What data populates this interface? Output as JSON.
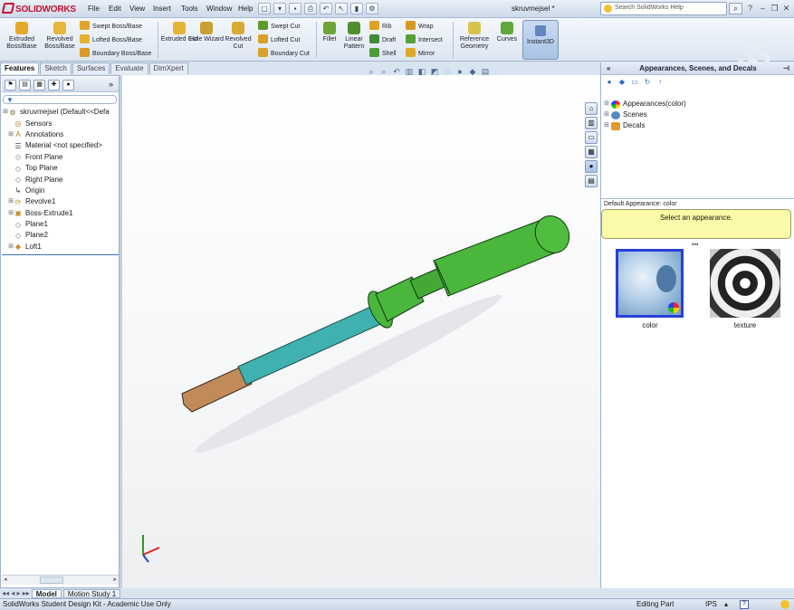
{
  "app": {
    "logo_text": "SOLIDWORKS",
    "document_title": "skruvmejsel *"
  },
  "menu": [
    "File",
    "Edit",
    "View",
    "Insert",
    "Tools",
    "Window",
    "Help"
  ],
  "search": {
    "placeholder": "Search SolidWorks Help"
  },
  "commands": {
    "extruded_boss": "Extruded Boss/Base",
    "revolved_boss": "Revolved Boss/Base",
    "swept_boss": "Swept Boss/Base",
    "lofted_boss": "Lofted Boss/Base",
    "boundary_boss": "Boundary Boss/Base",
    "extruded_cut": "Extruded Cut",
    "hole_wizard": "Hole Wizard",
    "revolved_cut": "Revolved Cut",
    "swept_cut": "Swept Cut",
    "lofted_cut": "Lofted Cut",
    "boundary_cut": "Boundary Cut",
    "fillet": "Fillet",
    "linear_pattern": "Linear Pattern",
    "rib": "Rib",
    "draft": "Draft",
    "shell": "Shell",
    "wrap": "Wrap",
    "intersect": "Intersect",
    "mirror": "Mirror",
    "reference_geometry": "Reference Geometry",
    "curves": "Curves",
    "instant3d": "Instant3D"
  },
  "tabs": [
    "Features",
    "Sketch",
    "Surfaces",
    "Evaluate",
    "DimXpert"
  ],
  "tree": [
    {
      "label": "skruvmejsel  (Default<<Defa",
      "icon": "part-icon",
      "indent": 0
    },
    {
      "label": "Sensors",
      "icon": "sensors-icon",
      "indent": 1
    },
    {
      "label": "Annotations",
      "icon": "annotations-icon",
      "indent": 1
    },
    {
      "label": "Material <not specified>",
      "icon": "material-icon",
      "indent": 1
    },
    {
      "label": "Front Plane",
      "icon": "plane-icon",
      "indent": 1
    },
    {
      "label": "Top Plane",
      "icon": "plane-icon",
      "indent": 1
    },
    {
      "label": "Right Plane",
      "icon": "plane-icon",
      "indent": 1
    },
    {
      "label": "Origin",
      "icon": "origin-icon",
      "indent": 1
    },
    {
      "label": "Revolve1",
      "icon": "revolve-icon",
      "indent": 1
    },
    {
      "label": "Boss-Extrude1",
      "icon": "extrude-icon",
      "indent": 1
    },
    {
      "label": "Plane1",
      "icon": "plane-icon",
      "indent": 1
    },
    {
      "label": "Plane2",
      "icon": "plane-icon",
      "indent": 1
    },
    {
      "label": "Loft1",
      "icon": "loft-icon",
      "indent": 1
    }
  ],
  "bottom_tabs": [
    "Model",
    "Motion Study 1"
  ],
  "right_panel": {
    "title": "Appearances, Scenes, and Decals",
    "tree": [
      "Appearances(color)",
      "Scenes",
      "Decals"
    ],
    "default_appearance": "Default Appearance: color",
    "hint": "Select an appearance.",
    "swatches": [
      "color",
      "texture"
    ]
  },
  "status": {
    "left": "SolidWorks Student Design Kit - Academic Use Only",
    "mode": "Editing Part",
    "units": "IPS"
  },
  "colors": {
    "handle": "#4bb63c",
    "shaft": "#3fb1b1",
    "tip": "#c08a5a",
    "accent": "#2a3fd8"
  }
}
